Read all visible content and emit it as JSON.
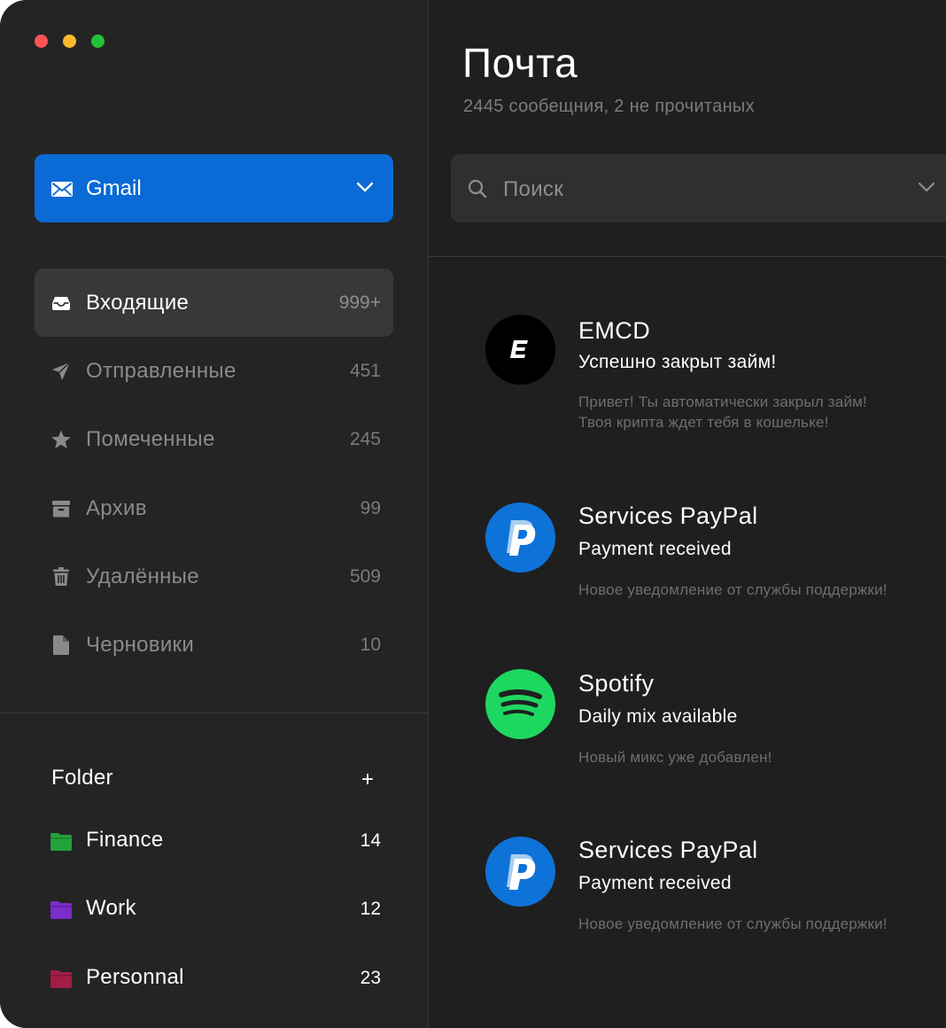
{
  "colors": {
    "accent": "#0a6ad6",
    "window_bg": "#1f1f20",
    "sidebar_bg": "#242425",
    "active_item_bg": "#38383a",
    "finance_folder": "#23a33b",
    "work_folder": "#7b2cc9",
    "personal_folder": "#a31d44",
    "paypal_blue": "#0e73d8",
    "spotify_green": "#1ed760"
  },
  "window": {
    "traffic_lights": [
      "close",
      "minimize",
      "zoom"
    ]
  },
  "sidebar": {
    "account": {
      "label": "Gmail",
      "icon": "mail-icon"
    },
    "items": [
      {
        "label": "Входящие",
        "count": "999+",
        "icon": "inbox-icon",
        "active": true
      },
      {
        "label": "Отправленные",
        "count": "451",
        "icon": "send-icon"
      },
      {
        "label": "Помеченные",
        "count": "245",
        "icon": "star-icon"
      },
      {
        "label": "Архив",
        "count": "99",
        "icon": "archive-icon"
      },
      {
        "label": "Удалённые",
        "count": "509",
        "icon": "trash-icon"
      },
      {
        "label": "Черновики",
        "count": "10",
        "icon": "draft-icon"
      }
    ],
    "folders": {
      "title": "Folder",
      "add_label": "+",
      "items": [
        {
          "label": "Finance",
          "count": "14",
          "icon": "folder-icon"
        },
        {
          "label": "Work",
          "count": "12",
          "icon": "folder-icon"
        },
        {
          "label": "Personnal",
          "count": "23",
          "icon": "folder-icon"
        }
      ]
    }
  },
  "main": {
    "title": "Почта",
    "subtitle": "2445 сообещния, 2 не прочитаных",
    "search": {
      "placeholder": "Поиск"
    },
    "messages": [
      {
        "sender": "EMCD",
        "subject": "Успешно закрыт займ!",
        "preview_line1": "Привет! Ты автоматически закрыл займ!",
        "preview_line2": "Твоя крипта ждет тебя в кошельке!",
        "avatar": "emcd-logo"
      },
      {
        "sender": "Services PayPal",
        "subject": "Payment received",
        "preview_line1": "Новое уведомление от службы поддержки!",
        "avatar": "paypal-logo"
      },
      {
        "sender": "Spotify",
        "subject": "Daily mix available",
        "preview_line1": "Новый микс уже добавлен!",
        "avatar": "spotify-logo"
      },
      {
        "sender": "Services PayPal",
        "subject": "Payment received",
        "preview_line1": "Новое уведомление от службы поддержки!",
        "avatar": "paypal-logo"
      }
    ]
  }
}
